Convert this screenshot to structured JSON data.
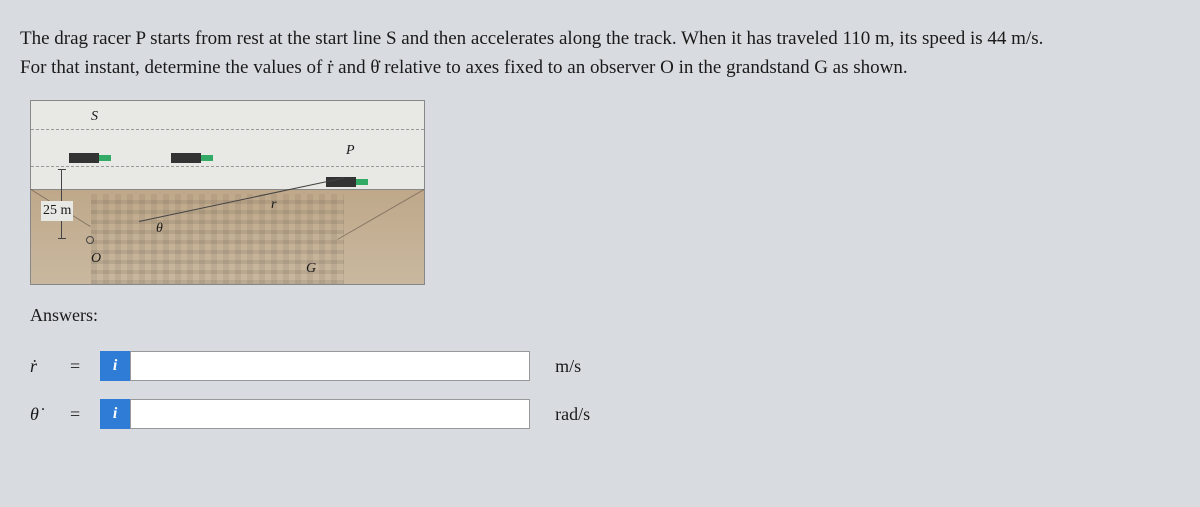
{
  "problem": {
    "line1": "The drag racer P starts from rest at the start line S and then accelerates along the track. When it has traveled 110 m, its speed is 44 m/s.",
    "line2": "For that instant, determine the values of ṙ and θ̇ relative to axes fixed to an observer O in the grandstand G as shown."
  },
  "diagram": {
    "label_S": "S",
    "label_P": "P",
    "label_r": "r",
    "label_theta": "θ",
    "label_O": "O",
    "label_G": "G",
    "distance": "25 m"
  },
  "answers": {
    "heading": "Answers:",
    "info_glyph": "i",
    "rows": [
      {
        "var": "ṙ",
        "eq": "=",
        "value": "",
        "unit": "m/s"
      },
      {
        "var": "θ̇",
        "eq": "=",
        "value": "",
        "unit": "rad/s"
      }
    ]
  }
}
